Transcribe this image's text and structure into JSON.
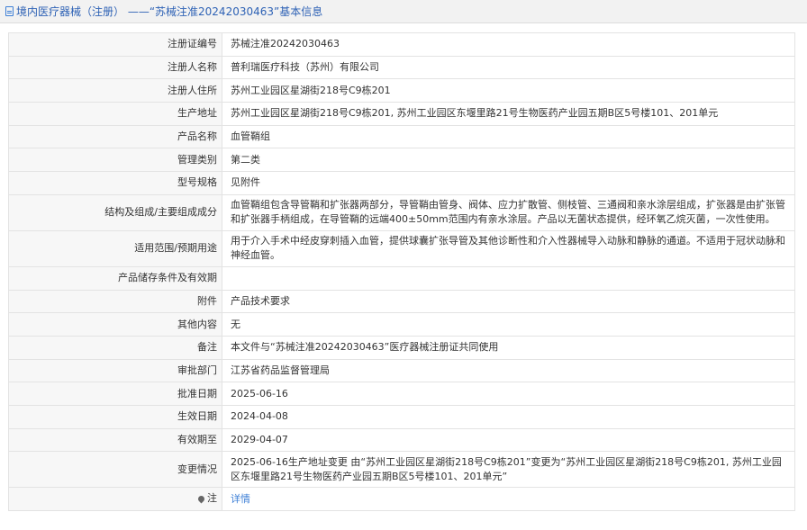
{
  "header": {
    "icon": "document-icon",
    "title": "境内医疗器械（注册） ——“苏械注准20242030463”基本信息"
  },
  "rows": [
    {
      "label": "注册证编号",
      "value": "苏械注准20242030463"
    },
    {
      "label": "注册人名称",
      "value": "普利瑞医疗科技（苏州）有限公司"
    },
    {
      "label": "注册人住所",
      "value": "苏州工业园区星湖街218号C9栋201"
    },
    {
      "label": "生产地址",
      "value": "苏州工业园区星湖街218号C9栋201, 苏州工业园区东堰里路21号生物医药产业园五期B区5号楼101、201单元"
    },
    {
      "label": "产品名称",
      "value": "血管鞘组"
    },
    {
      "label": "管理类别",
      "value": "第二类"
    },
    {
      "label": "型号规格",
      "value": "见附件"
    },
    {
      "label": "结构及组成/主要组成成分",
      "value": "血管鞘组包含导管鞘和扩张器两部分，导管鞘由管身、阀体、应力扩散管、侧枝管、三通阀和亲水涂层组成，扩张器是由扩张管和扩张器手柄组成，在导管鞘的远端400±50mm范围内有亲水涂层。产品以无菌状态提供，经环氧乙烷灭菌，一次性使用。"
    },
    {
      "label": "适用范围/预期用途",
      "value": "用于介入手术中经皮穿刺插入血管，提供球囊扩张导管及其他诊断性和介入性器械导入动脉和静脉的通道。不适用于冠状动脉和神经血管。"
    },
    {
      "label": "产品储存条件及有效期",
      "value": ""
    },
    {
      "label": "附件",
      "value": "产品技术要求"
    },
    {
      "label": "其他内容",
      "value": "无"
    },
    {
      "label": "备注",
      "value": "本文件与“苏械注准20242030463”医疗器械注册证共同使用"
    },
    {
      "label": "审批部门",
      "value": "江苏省药品监督管理局"
    },
    {
      "label": "批准日期",
      "value": "2025-06-16"
    },
    {
      "label": "生效日期",
      "value": "2024-04-08"
    },
    {
      "label": "有效期至",
      "value": "2029-04-07"
    },
    {
      "label": "变更情况",
      "value": "2025-06-16生产地址变更 由“苏州工业园区星湖街218号C9栋201”变更为“苏州工业园区星湖街218号C9栋201, 苏州工业园区东堰里路21号生物医药产业园五期B区5号楼101、201单元”"
    }
  ],
  "note_row": {
    "icon": "pin-icon",
    "label": "注",
    "link_text": "详情",
    "link_color": "#3d7fd6"
  }
}
